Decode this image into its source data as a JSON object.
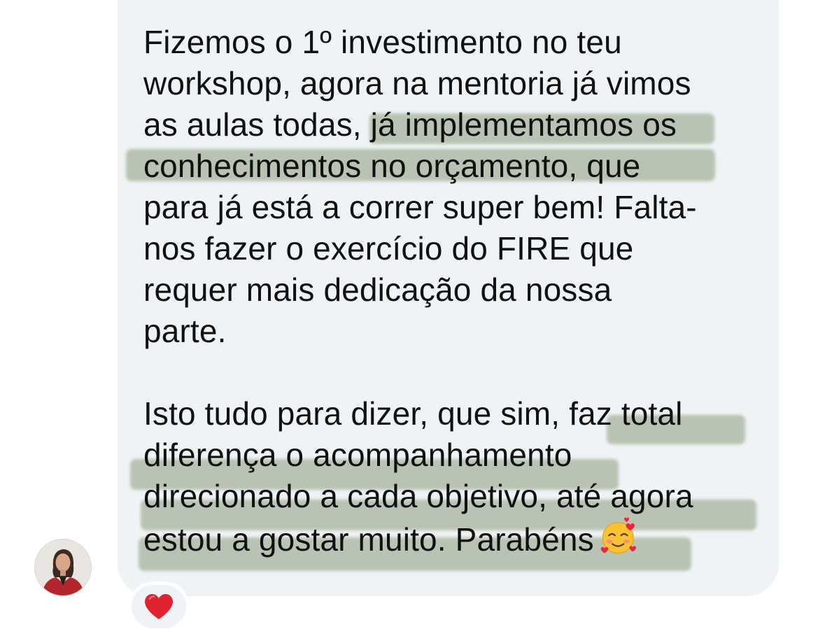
{
  "message": {
    "paragraph1": [
      "Fizemos o 1º investimento no teu",
      "workshop, agora na mentoria já vimos",
      "as aulas todas, já implementamos os",
      "conhecimentos no orçamento, que",
      "para já está a correr super bem! Falta-",
      "nos fazer o exercício do FIRE que",
      "requer mais dedicação da nossa",
      "parte."
    ],
    "paragraph2": [
      "Isto tudo para dizer, que sim, faz total",
      "diferença o acompanhamento",
      "direcionado a cada objetivo, até agora",
      "estou a gostar muito. Parabéns"
    ]
  },
  "emoji": "smiling-face-with-hearts",
  "reaction": "red-heart",
  "avatar": "sender-avatar-woman-red-jacket",
  "colors": {
    "bubble": "#eff3f5",
    "text": "#111111",
    "highlight": "#7d8c66",
    "reaction_heart": "#e0242f"
  }
}
